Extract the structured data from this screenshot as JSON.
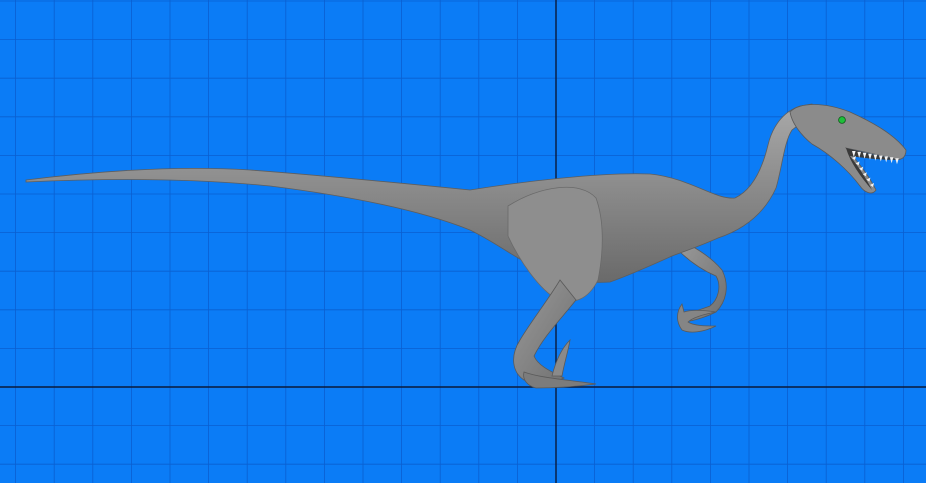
{
  "viewport": {
    "view": "orthographic-side",
    "background_color": "#0b7cf6",
    "grid_line_color": "#0a5fd0",
    "axis_line_color": "#0a1a3a",
    "grid_visible": true,
    "axes_visible": true
  },
  "model": {
    "subject": "dinosaur-model",
    "body_color": "#8a8a8a",
    "highlight_color": "#b3b3b3",
    "shadow_color": "#5e5e5e",
    "eye_color": "#1fbf3a",
    "teeth_color": "#f2f2f2"
  }
}
